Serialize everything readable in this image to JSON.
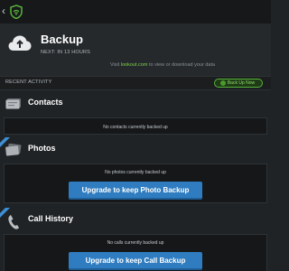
{
  "header": {
    "title": "Backup",
    "next_backup": "NEXT: IN 13 HOURS",
    "visit_prefix": "Visit ",
    "visit_link": "lookout.com",
    "visit_suffix": " to view or download your data"
  },
  "activity": {
    "label": "RECENT ACTIVITY",
    "backup_now_label": "Back Up Now"
  },
  "sections": {
    "contacts": {
      "title": "Contacts",
      "message": "No contacts currently backed up"
    },
    "photos": {
      "title": "Photos",
      "message": "No photos currently backed up",
      "button": "Upgrade to keep Photo Backup"
    },
    "call_history": {
      "title": "Call History",
      "message": "No calls currently backed up",
      "button": "Upgrade to keep Call Backup"
    }
  },
  "colors": {
    "accent_green": "#58b33a",
    "button_blue": "#2f7dc0",
    "background": "#202326"
  },
  "icons": [
    "back-icon",
    "lookout-shield-icon",
    "cloud-upload-icon",
    "contacts-card-icon",
    "photos-icon",
    "phone-icon",
    "premium-ribbon-icon"
  ]
}
